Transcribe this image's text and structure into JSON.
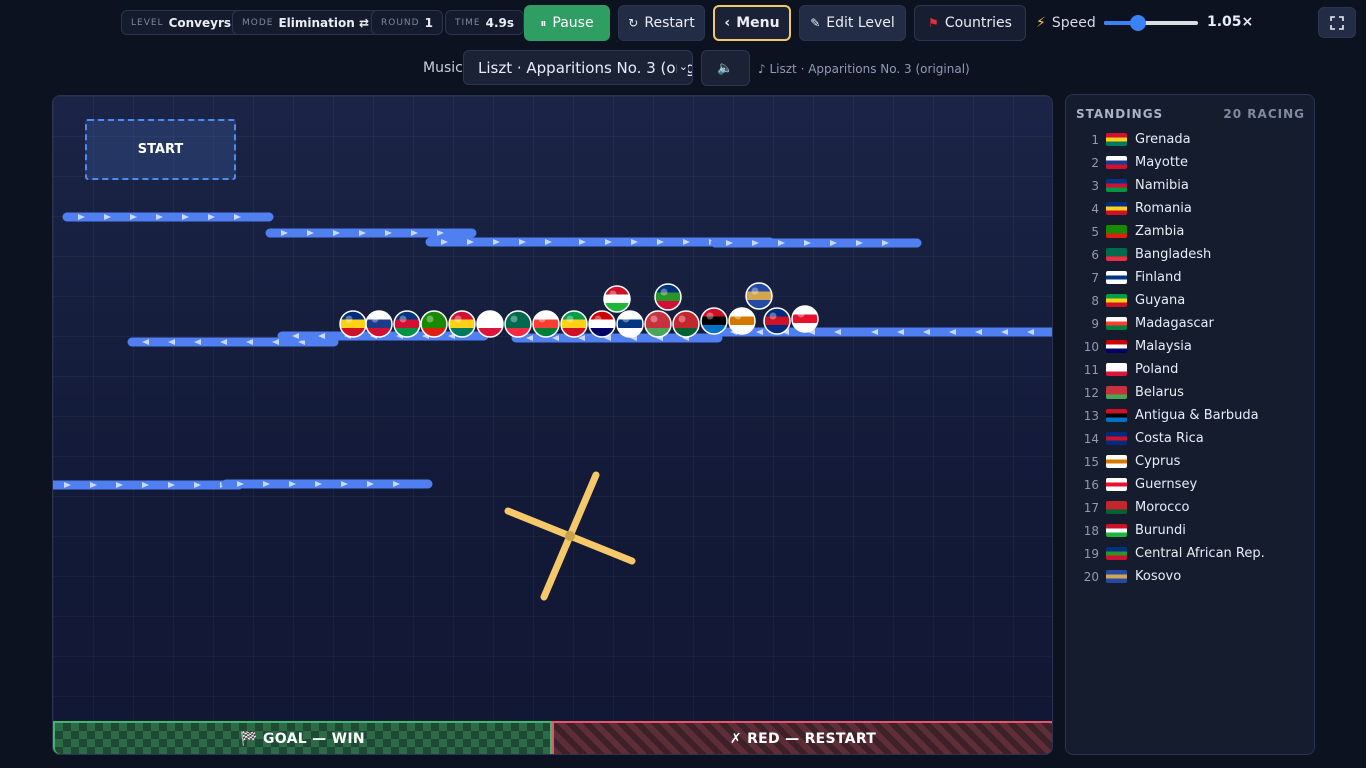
{
  "hud": {
    "level": {
      "key": "LEVEL",
      "value": "Conveyrs"
    },
    "mode": {
      "key": "MODE",
      "value": "Elimination ⇄"
    },
    "round": {
      "key": "ROUND",
      "value": "1"
    },
    "time": {
      "key": "TIME",
      "value": "4.9s"
    }
  },
  "toolbar": {
    "pause": {
      "icon": "pause-icon",
      "label": "Pause",
      "glyph": "⏸"
    },
    "restart": {
      "icon": "restart-icon",
      "label": "Restart",
      "glyph": "↻"
    },
    "menu": {
      "icon": "chevron-left-icon",
      "label": "Menu",
      "glyph": "‹"
    },
    "edit": {
      "icon": "pencil-icon",
      "label": "Edit Level",
      "glyph": "✎"
    },
    "countries": {
      "icon": "flag-icon",
      "label": "Countries",
      "glyph": "⚑"
    },
    "speed": {
      "label": "Speed",
      "value": 1.05,
      "value_text": "1.05×",
      "icon": "lightning-icon",
      "glyph": "⚡",
      "slider_fraction": 0.36
    },
    "fullscreen": {
      "icon": "fullscreen-icon"
    }
  },
  "music": {
    "label": "Music",
    "selected": "Liszt · Apparitions No. 3 (original)",
    "now_playing": "♪ Liszt · Apparitions No. 3 (original)",
    "volume_icon": "speaker-icon",
    "volume_glyph": "🔈"
  },
  "board": {
    "start_label": "START",
    "goal_label": "🏁 GOAL — WIN",
    "red_label": "✗ RED — RESTART",
    "colors": {
      "conveyor": "#4f7ff0",
      "spinner": "#f5c869",
      "goal": "#3fb86b",
      "red": "#e5566a"
    }
  },
  "standings": {
    "title": "STANDINGS",
    "count_label": "20 RACING",
    "entries": [
      {
        "rank": "1",
        "name": "Grenada",
        "flag": "flag-grenada-icon",
        "colors": [
          "#d21034",
          "#fcd116",
          "#007a5e"
        ]
      },
      {
        "rank": "2",
        "name": "Mayotte",
        "flag": "flag-mayotte-icon",
        "colors": [
          "#ffffff",
          "#1e3a8a",
          "#d21034"
        ]
      },
      {
        "rank": "3",
        "name": "Namibia",
        "flag": "flag-namibia-icon",
        "colors": [
          "#003580",
          "#d21034",
          "#009543"
        ]
      },
      {
        "rank": "4",
        "name": "Romania",
        "flag": "flag-romania-icon",
        "colors": [
          "#002b7f",
          "#fcd116",
          "#ce1126"
        ]
      },
      {
        "rank": "5",
        "name": "Zambia",
        "flag": "flag-zambia-icon",
        "colors": [
          "#198a00",
          "#198a00",
          "#de2010"
        ]
      },
      {
        "rank": "6",
        "name": "Bangladesh",
        "flag": "flag-bangladesh-icon",
        "colors": [
          "#006a4e",
          "#006a4e",
          "#f42a41"
        ]
      },
      {
        "rank": "7",
        "name": "Finland",
        "flag": "flag-finland-icon",
        "colors": [
          "#ffffff",
          "#003580",
          "#ffffff"
        ]
      },
      {
        "rank": "8",
        "name": "Guyana",
        "flag": "flag-guyana-icon",
        "colors": [
          "#009e49",
          "#fcd116",
          "#ce1126"
        ]
      },
      {
        "rank": "9",
        "name": "Madagascar",
        "flag": "flag-madagascar-icon",
        "colors": [
          "#ffffff",
          "#fc3d32",
          "#007e3a"
        ]
      },
      {
        "rank": "10",
        "name": "Malaysia",
        "flag": "flag-malaysia-icon",
        "colors": [
          "#cc0001",
          "#ffffff",
          "#010066"
        ]
      },
      {
        "rank": "11",
        "name": "Poland",
        "flag": "flag-poland-icon",
        "colors": [
          "#ffffff",
          "#ffffff",
          "#dc143c"
        ]
      },
      {
        "rank": "12",
        "name": "Belarus",
        "flag": "flag-belarus-icon",
        "colors": [
          "#c8313e",
          "#c8313e",
          "#4aa657"
        ]
      },
      {
        "rank": "13",
        "name": "Antigua & Barbuda",
        "flag": "flag-antigua-barbuda-icon",
        "colors": [
          "#ce1126",
          "#000000",
          "#0072c6"
        ]
      },
      {
        "rank": "14",
        "name": "Costa Rica",
        "flag": "flag-costa-rica-icon",
        "colors": [
          "#002b7f",
          "#ce1126",
          "#002b7f"
        ]
      },
      {
        "rank": "15",
        "name": "Cyprus",
        "flag": "flag-cyprus-icon",
        "colors": [
          "#ffffff",
          "#d57800",
          "#ffffff"
        ]
      },
      {
        "rank": "16",
        "name": "Guernsey",
        "flag": "flag-guernsey-icon",
        "colors": [
          "#ffffff",
          "#e8112d",
          "#ffffff"
        ]
      },
      {
        "rank": "17",
        "name": "Morocco",
        "flag": "flag-morocco-icon",
        "colors": [
          "#c1272d",
          "#c1272d",
          "#006233"
        ]
      },
      {
        "rank": "18",
        "name": "Burundi",
        "flag": "flag-burundi-icon",
        "colors": [
          "#ce1126",
          "#ffffff",
          "#1eb53a"
        ]
      },
      {
        "rank": "19",
        "name": "Central African Rep.",
        "flag": "flag-central-african-rep-icon",
        "colors": [
          "#003082",
          "#289728",
          "#d21034"
        ]
      },
      {
        "rank": "20",
        "name": "Kosovo",
        "flag": "flag-kosovo-icon",
        "colors": [
          "#244aa5",
          "#d0a650",
          "#244aa5"
        ]
      }
    ]
  },
  "marbles": [
    {
      "name": "Romania",
      "colors": [
        "#002b7f",
        "#fcd116",
        "#ce1126"
      ]
    },
    {
      "name": "Mayotte",
      "colors": [
        "#ffffff",
        "#1e3a8a",
        "#d21034"
      ]
    },
    {
      "name": "Namibia",
      "colors": [
        "#003580",
        "#d21034",
        "#009543"
      ]
    },
    {
      "name": "Zambia",
      "colors": [
        "#198a00",
        "#198a00",
        "#de2010"
      ]
    },
    {
      "name": "Grenada",
      "colors": [
        "#d21034",
        "#fcd116",
        "#007a5e"
      ]
    },
    {
      "name": "Poland",
      "colors": [
        "#ffffff",
        "#ffffff",
        "#dc143c"
      ]
    },
    {
      "name": "Bangladesh",
      "colors": [
        "#006a4e",
        "#006a4e",
        "#f42a41"
      ]
    },
    {
      "name": "Madagascar",
      "colors": [
        "#ffffff",
        "#fc3d32",
        "#007e3a"
      ]
    },
    {
      "name": "Guyana",
      "colors": [
        "#009e49",
        "#fcd116",
        "#ce1126"
      ]
    },
    {
      "name": "Malaysia",
      "colors": [
        "#cc0001",
        "#ffffff",
        "#010066"
      ]
    },
    {
      "name": "Finland",
      "colors": [
        "#ffffff",
        "#003580",
        "#ffffff"
      ]
    },
    {
      "name": "Belarus",
      "colors": [
        "#c8313e",
        "#c8313e",
        "#4aa657"
      ]
    },
    {
      "name": "Morocco",
      "colors": [
        "#c1272d",
        "#c1272d",
        "#006233"
      ]
    },
    {
      "name": "Antigua & Barbuda",
      "colors": [
        "#ce1126",
        "#000000",
        "#0072c6"
      ]
    },
    {
      "name": "Cyprus",
      "colors": [
        "#ffffff",
        "#d57800",
        "#ffffff"
      ]
    },
    {
      "name": "Costa Rica",
      "colors": [
        "#002b7f",
        "#ce1126",
        "#002b7f"
      ]
    },
    {
      "name": "Guernsey",
      "colors": [
        "#ffffff",
        "#e8112d",
        "#ffffff"
      ]
    },
    {
      "name": "Burundi",
      "colors": [
        "#ce1126",
        "#ffffff",
        "#1eb53a"
      ]
    },
    {
      "name": "Central African Rep.",
      "colors": [
        "#003082",
        "#289728",
        "#d21034"
      ]
    },
    {
      "name": "Kosovo",
      "colors": [
        "#244aa5",
        "#d0a650",
        "#244aa5"
      ]
    }
  ]
}
